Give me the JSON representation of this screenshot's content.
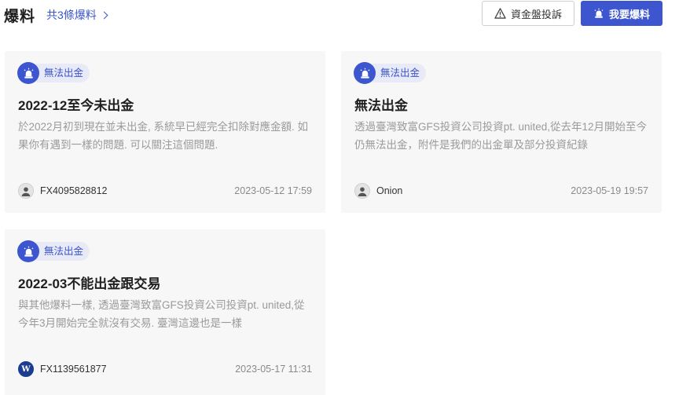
{
  "header": {
    "title": "爆料",
    "count_link": "共3條爆料",
    "complaint_button": "資金盤投訴",
    "report_button": "我要爆料"
  },
  "cards": [
    {
      "tag": "無法出金",
      "title": "2022-12至今未出金",
      "description": "於2022月初到現在並未出金, 系統早已經完全扣除對應金額. 如果你有遇到一樣的問題. 可以關注這個問題.",
      "username": "FX4095828812",
      "date": "2023-05-12 17:59",
      "avatar_icon": "user-silhouette-icon"
    },
    {
      "tag": "無法出金",
      "title": "無法出金",
      "description": "透過臺灣致富GFS投資公司投資pt. united,從去年12月開始至今仍無法出金，附件是我們的出金單及部分投資紀錄",
      "username": "Onion",
      "date": "2023-05-19 19:57",
      "avatar_icon": "user-silhouette-icon"
    },
    {
      "tag": "無法出金",
      "title": "2022-03不能出金跟交易",
      "description": "與其他爆料一樣, 透過臺灣致富GFS投資公司投資pt. united,從今年3月開始完全就沒有交易. 臺灣這邊也是一樣",
      "username": "FX1139561877",
      "date": "2023-05-17 11:31",
      "avatar_icon": "w-logo-icon",
      "avatar_letter": "W"
    }
  ],
  "colors": {
    "accent": "#3d56d0",
    "tag_bg": "#e8ebf7",
    "card_bg": "#f7f7f8",
    "muted_text": "#9a9a9a"
  }
}
